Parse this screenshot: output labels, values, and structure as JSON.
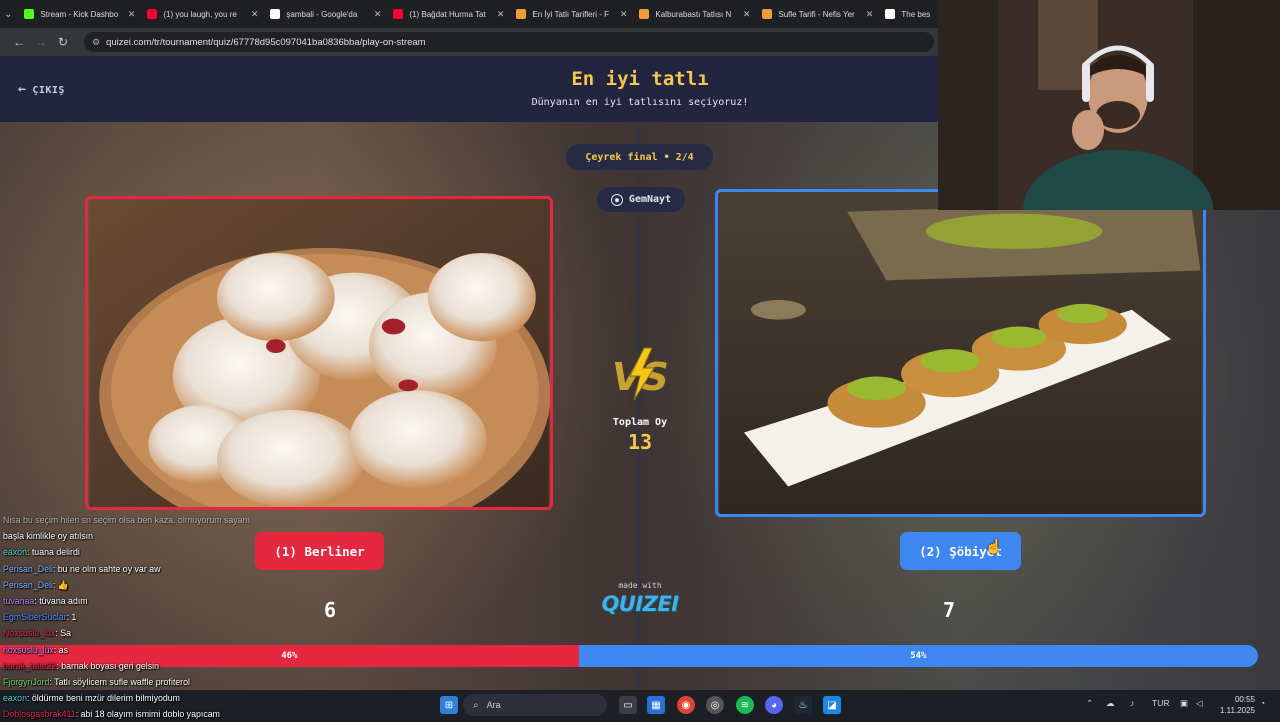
{
  "browser": {
    "tabs": [
      {
        "label": "Stream - Kick Dashbo",
        "icon": "kick-icon",
        "color": "#53fc18",
        "active": false
      },
      {
        "label": "(1) you laugh, you re",
        "icon": "youtube-icon",
        "color": "#ff0033",
        "active": false
      },
      {
        "label": "şambali - Google'da",
        "icon": "google-icon",
        "color": "#ffffff",
        "active": false
      },
      {
        "label": "(1) Bağdat Hurma Tat",
        "icon": "youtube-icon",
        "color": "#ff0033",
        "active": false
      },
      {
        "label": "En İyi Tatlı Tarifleri - F",
        "icon": "bookmark-icon",
        "color": "#f29c38",
        "active": false
      },
      {
        "label": "Kalburabastı Tatlısı N",
        "icon": "bookmark-icon",
        "color": "#f29c38",
        "active": false
      },
      {
        "label": "Sufle Tarifi - Nefis Yer",
        "icon": "bookmark-icon",
        "color": "#f29c38",
        "active": false
      },
      {
        "label": "The bes",
        "icon": "diamond-icon",
        "color": "#ffffff",
        "active": false
      }
    ],
    "url": "quizei.com/tr/tournament/quiz/67778d95c097041ba0836bba/play-on-stream"
  },
  "quiz": {
    "back_label": "ÇIKIŞ",
    "title": "En iyi tatlı",
    "subtitle": "Dünyanın en iyi tatlısını seçiyoruz!",
    "round": "Çeyrek final • 2/4",
    "user": "GemNayt",
    "total_label": "Toplam Oy",
    "total_votes": "13",
    "made_with": "made with",
    "brand": "QUIZEI",
    "left": {
      "button": "(1) Berliner",
      "votes": "6",
      "percent": 46,
      "percent_label": "46%",
      "color": "#e5283f"
    },
    "right": {
      "button": "(2) Şöbiyet",
      "votes": "7",
      "percent": 54,
      "percent_label": "54%",
      "color": "#3f87f0"
    }
  },
  "chat": [
    {
      "user": "",
      "color": "#ffffff",
      "text": "Nisa bu seçim hilen sn seçim olsa ben kaza. olmuyorum sayam"
    },
    {
      "user": "",
      "color": "#ffffff",
      "text": "başla kimlikle oy atılsın"
    },
    {
      "user": "eaxon",
      "color": "#4fd1c5",
      "text": ": tuana delirdi"
    },
    {
      "user": "Perisan_Deli",
      "color": "#7fb2ff",
      "text": ": bu ne olm sahte oy var aw"
    },
    {
      "user": "Perisan_Deli",
      "color": "#7fb2ff",
      "text": ": 👍"
    },
    {
      "user": "tuvanaa",
      "color": "#b483ff",
      "text": ": tüvana adım"
    },
    {
      "user": "EgmSiberSuclar",
      "color": "#4f8cff",
      "text": ": 1"
    },
    {
      "user": "Noxsuslu_lux",
      "color": "#e0284f",
      "text": ": Sa"
    },
    {
      "user": "noxsuslu_lux",
      "color": "#b483ff",
      "text": ": as"
    },
    {
      "user": "burak_talat22",
      "color": "#e0284f",
      "text": ": barnak boyası geri gelsin"
    },
    {
      "user": "FjorgynJord",
      "color": "#6fd36f",
      "text": ": Tatlı söylicem sufle waffle profiterol"
    },
    {
      "user": "eaxon",
      "color": "#4fd1c5",
      "text": ": öldürme beni mzür dilerim bilmiyodum"
    },
    {
      "user": "Doblosgasbrak411",
      "color": "#e0284f",
      "text": ": abi 18 olayım ismimi doblo yapıcam"
    }
  ],
  "taskbar": {
    "search_placeholder": "Ara",
    "lang": "TUR",
    "time": "00:55",
    "date": "1.11.2025"
  }
}
